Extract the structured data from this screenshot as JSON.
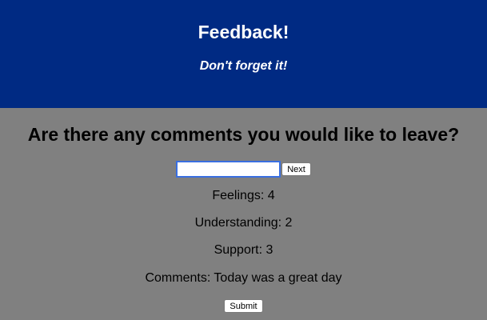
{
  "header": {
    "title": "Feedback!",
    "subtitle": "Don't forget it!"
  },
  "colors": {
    "header_bg": "#002a83",
    "page_bg": "#808080",
    "focus_ring": "#3a6fe0"
  },
  "form": {
    "question": "Are there any comments you would like to leave?",
    "input_value": "",
    "next_label": "Next",
    "submit_label": "Submit"
  },
  "results": {
    "feelings": "Feelings: 4",
    "understanding": "Understanding: 2",
    "support": "Support: 3",
    "comments": "Comments: Today was a great day"
  }
}
